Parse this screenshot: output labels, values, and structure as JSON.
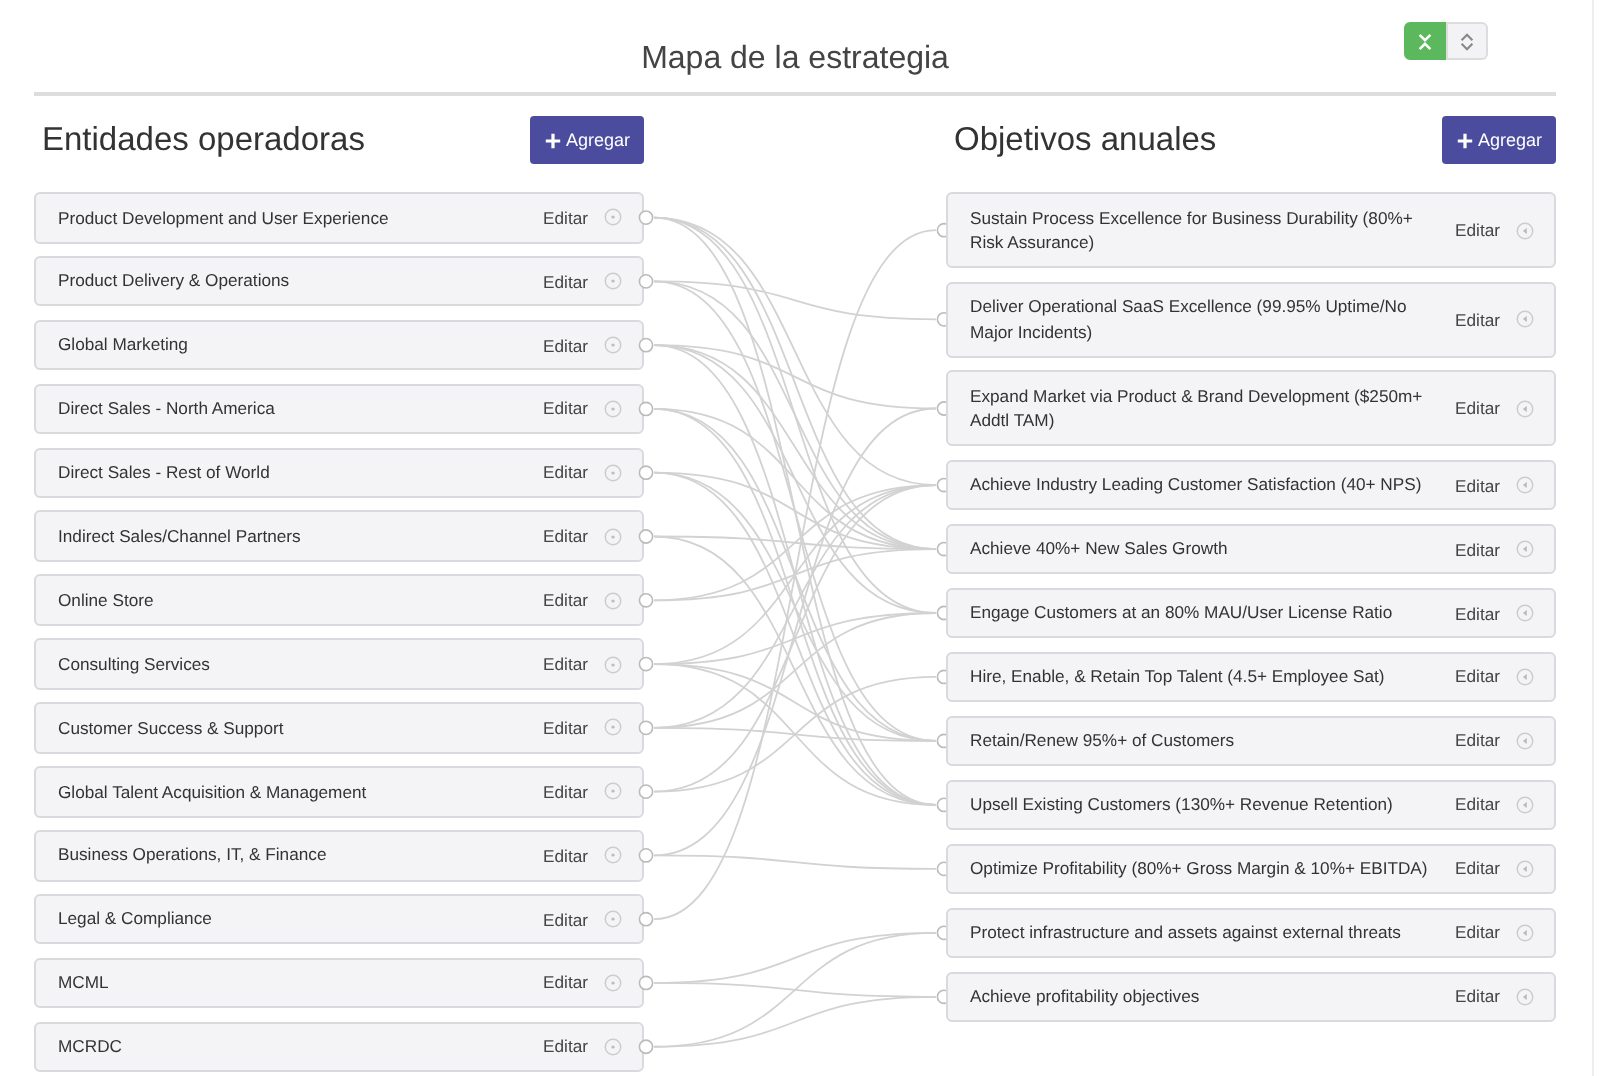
{
  "title": "Mapa de la estrategia",
  "view_toggle": [
    {
      "kind": "collapse",
      "selected": true
    },
    {
      "kind": "expand",
      "selected": false
    }
  ],
  "left": {
    "heading": "Entidades operadoras",
    "add_button": "Agregar",
    "items": [
      {
        "label": "Product Development and User Experience",
        "action": "Editar"
      },
      {
        "label": "Product Delivery & Operations",
        "action": "Editar"
      },
      {
        "label": "Global Marketing",
        "action": "Editar"
      },
      {
        "label": "Direct Sales - North America",
        "action": "Editar"
      },
      {
        "label": "Direct Sales - Rest of World",
        "action": "Editar"
      },
      {
        "label": "Indirect Sales/Channel Partners",
        "action": "Editar"
      },
      {
        "label": "Online Store",
        "action": "Editar"
      },
      {
        "label": "Consulting Services",
        "action": "Editar"
      },
      {
        "label": "Customer Success & Support",
        "action": "Editar"
      },
      {
        "label": "Global Talent Acquisition & Management",
        "action": "Editar"
      },
      {
        "label": "Business Operations, IT, & Finance",
        "action": "Editar"
      },
      {
        "label": "Legal & Compliance",
        "action": "Editar"
      },
      {
        "label": "MCML",
        "action": "Editar"
      },
      {
        "label": "MCRDC",
        "action": "Editar"
      }
    ]
  },
  "right": {
    "heading": "Objetivos anuales",
    "add_button": "Agregar",
    "items": [
      {
        "label": "Sustain Process Excellence for Business Durability (80%+ Risk Assurance)",
        "action": "Editar"
      },
      {
        "label": "Deliver Operational SaaS Excellence (99.95% Uptime/No Major Incidents)",
        "action": "Editar"
      },
      {
        "label": "Expand Market via Product & Brand Development ($250m+ Addtl TAM)",
        "action": "Editar"
      },
      {
        "label": "Achieve Industry Leading Customer Satisfaction (40+ NPS)",
        "action": "Editar"
      },
      {
        "label": "Achieve 40%+ New Sales Growth",
        "action": "Editar"
      },
      {
        "label": "Engage Customers at an 80% MAU/User License Ratio",
        "action": "Editar"
      },
      {
        "label": "Hire, Enable, & Retain Top Talent (4.5+ Employee Sat)",
        "action": "Editar"
      },
      {
        "label": "Retain/Renew 95%+ of Customers",
        "action": "Editar"
      },
      {
        "label": "Upsell Existing Customers (130%+ Revenue Retention)",
        "action": "Editar"
      },
      {
        "label": "Optimize Profitability (80%+ Gross Margin & 10%+ EBITDA)",
        "action": "Editar"
      },
      {
        "label": "Protect infrastructure and assets against external threats",
        "action": "Editar"
      },
      {
        "label": "Achieve profitability objectives",
        "action": "Editar"
      }
    ]
  }
}
